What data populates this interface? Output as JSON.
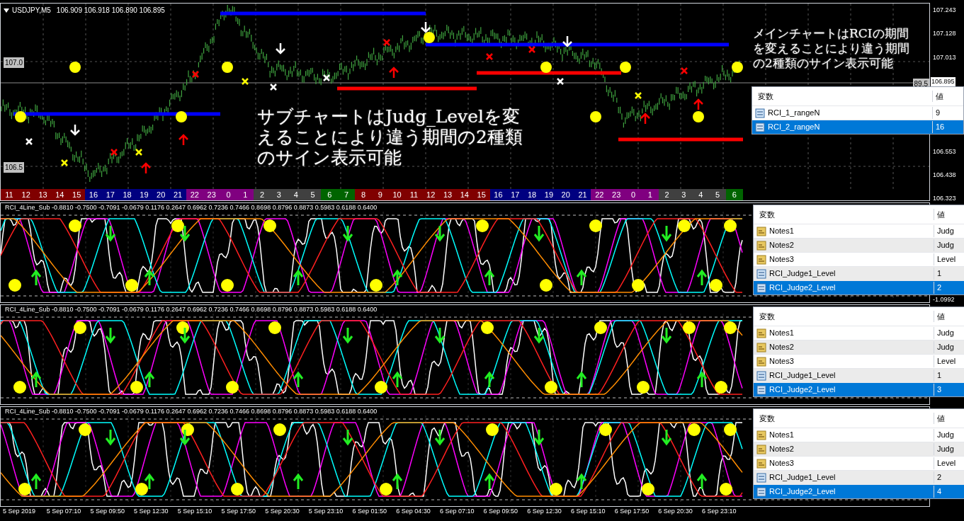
{
  "chart_header": {
    "symbol": "USDJPY,M5",
    "prices": "106.909 106.918 106.890 106.895"
  },
  "left_price_labels": [
    "107.0",
    "106.5"
  ],
  "price_axis": [
    "107.243",
    "107.128",
    "107.013",
    "106.553",
    "106.438",
    "106.323"
  ],
  "current_price": "106.895",
  "line_value_label": "89.5",
  "annotation_main": [
    "メインチャートはRCIの期間",
    "を変えることにより違う期間",
    "の2種類のサイン表示可能"
  ],
  "annotation_sub": [
    "サブチャートはJudg_Levelを変",
    "えることにより違う期間の2種類",
    "のサイン表示可能"
  ],
  "hour_bar": [
    {
      "label": "11",
      "color": "#800000"
    },
    {
      "label": "12",
      "color": "#800000"
    },
    {
      "label": "13",
      "color": "#800000"
    },
    {
      "label": "14",
      "color": "#800000"
    },
    {
      "label": "15",
      "color": "#800000"
    },
    {
      "label": "16",
      "color": "#000080"
    },
    {
      "label": "17",
      "color": "#000080"
    },
    {
      "label": "18",
      "color": "#000080"
    },
    {
      "label": "19",
      "color": "#000080"
    },
    {
      "label": "20",
      "color": "#000080"
    },
    {
      "label": "21",
      "color": "#000080"
    },
    {
      "label": "22",
      "color": "#800080"
    },
    {
      "label": "23",
      "color": "#800080"
    },
    {
      "label": "0",
      "color": "#800080"
    },
    {
      "label": "1",
      "color": "#800080"
    },
    {
      "label": "2",
      "color": "#404040"
    },
    {
      "label": "3",
      "color": "#404040"
    },
    {
      "label": "4",
      "color": "#404040"
    },
    {
      "label": "5",
      "color": "#404040"
    },
    {
      "label": "6",
      "color": "#006400"
    },
    {
      "label": "7",
      "color": "#006400"
    },
    {
      "label": "8",
      "color": "#800000"
    },
    {
      "label": "9",
      "color": "#800000"
    },
    {
      "label": "10",
      "color": "#800000"
    },
    {
      "label": "11",
      "color": "#800000"
    },
    {
      "label": "12",
      "color": "#800000"
    },
    {
      "label": "13",
      "color": "#800000"
    },
    {
      "label": "14",
      "color": "#800000"
    },
    {
      "label": "15",
      "color": "#800000"
    },
    {
      "label": "16",
      "color": "#000080"
    },
    {
      "label": "17",
      "color": "#000080"
    },
    {
      "label": "18",
      "color": "#000080"
    },
    {
      "label": "19",
      "color": "#000080"
    },
    {
      "label": "20",
      "color": "#000080"
    },
    {
      "label": "21",
      "color": "#000080"
    },
    {
      "label": "22",
      "color": "#800080"
    },
    {
      "label": "23",
      "color": "#800080"
    },
    {
      "label": "0",
      "color": "#800080"
    },
    {
      "label": "1",
      "color": "#800080"
    },
    {
      "label": "2",
      "color": "#404040"
    },
    {
      "label": "3",
      "color": "#404040"
    },
    {
      "label": "4",
      "color": "#404040"
    },
    {
      "label": "5",
      "color": "#404040"
    },
    {
      "label": "6",
      "color": "#006400"
    }
  ],
  "main_variables": {
    "headers": [
      "変数",
      "値"
    ],
    "rows": [
      {
        "kind": "number",
        "name": "RCI_1_rangeN",
        "value": "9",
        "selected": false
      },
      {
        "kind": "number",
        "name": "RCI_2_rangeN",
        "value": "16",
        "selected": true
      }
    ]
  },
  "subcharts": [
    {
      "title": "RCI_4Line_Sub -0.8810 -0.7500 -0.7091 -0.0679 0.1176 0.2647 0.6962 0.7236 0.7466 0.8698 0.8796 0.8873 0.5983 0.6188 0.6400",
      "axis_label": "-1.0992",
      "variables": {
        "headers": [
          "変数",
          "値"
        ],
        "rows": [
          {
            "kind": "text",
            "name": "Notes1",
            "value": "Judg",
            "selected": false
          },
          {
            "kind": "text",
            "name": "Notes2",
            "value": "Judg",
            "selected": false
          },
          {
            "kind": "text",
            "name": "Notes3",
            "value": "Level",
            "selected": false
          },
          {
            "kind": "number",
            "name": "RCI_Judge1_Level",
            "value": "1",
            "selected": false
          },
          {
            "kind": "number",
            "name": "RCI_Judge2_Level",
            "value": "2",
            "selected": true
          }
        ]
      }
    },
    {
      "title": "RCI_4Line_Sub -0.8810 -0.7500 -0.7091 -0.0679 0.1176 0.2647 0.6962 0.7236 0.7466 0.8698 0.8796 0.8873 0.5983 0.6188 0.6400",
      "variables": {
        "headers": [
          "変数",
          "値"
        ],
        "rows": [
          {
            "kind": "text",
            "name": "Notes1",
            "value": "Judg",
            "selected": false
          },
          {
            "kind": "text",
            "name": "Notes2",
            "value": "Judg",
            "selected": false
          },
          {
            "kind": "text",
            "name": "Notes3",
            "value": "Level",
            "selected": false
          },
          {
            "kind": "number",
            "name": "RCI_Judge1_Level",
            "value": "1",
            "selected": false
          },
          {
            "kind": "number",
            "name": "RCI_Judge2_Level",
            "value": "3",
            "selected": true
          }
        ]
      }
    },
    {
      "title": "RCI_4Line_Sub -0.8810 -0.7500 -0.7091 -0.0679 0.1176 0.2647 0.6962 0.7236 0.7466 0.8698 0.8796 0.8873 0.5983 0.6188 0.6400",
      "variables": {
        "headers": [
          "変数",
          "値"
        ],
        "rows": [
          {
            "kind": "text",
            "name": "Notes1",
            "value": "Judg",
            "selected": false
          },
          {
            "kind": "text",
            "name": "Notes2",
            "value": "Judg",
            "selected": false
          },
          {
            "kind": "text",
            "name": "Notes3",
            "value": "Level",
            "selected": false
          },
          {
            "kind": "number",
            "name": "RCI_Judge1_Level",
            "value": "2",
            "selected": false
          },
          {
            "kind": "number",
            "name": "RCI_Judge2_Level",
            "value": "4",
            "selected": true
          }
        ]
      }
    }
  ],
  "time_axis": [
    "5 Sep 2019",
    "5 Sep 07:10",
    "5 Sep 09:50",
    "5 Sep 12:30",
    "5 Sep 15:10",
    "5 Sep 17:50",
    "5 Sep 20:30",
    "5 Sep 23:10",
    "6 Sep 01:50",
    "6 Sep 04:30",
    "6 Sep 07:10",
    "6 Sep 09:50",
    "6 Sep 12:30",
    "6 Sep 15:10",
    "6 Sep 17:50",
    "6 Sep 20:30",
    "6 Sep 23:10"
  ]
}
